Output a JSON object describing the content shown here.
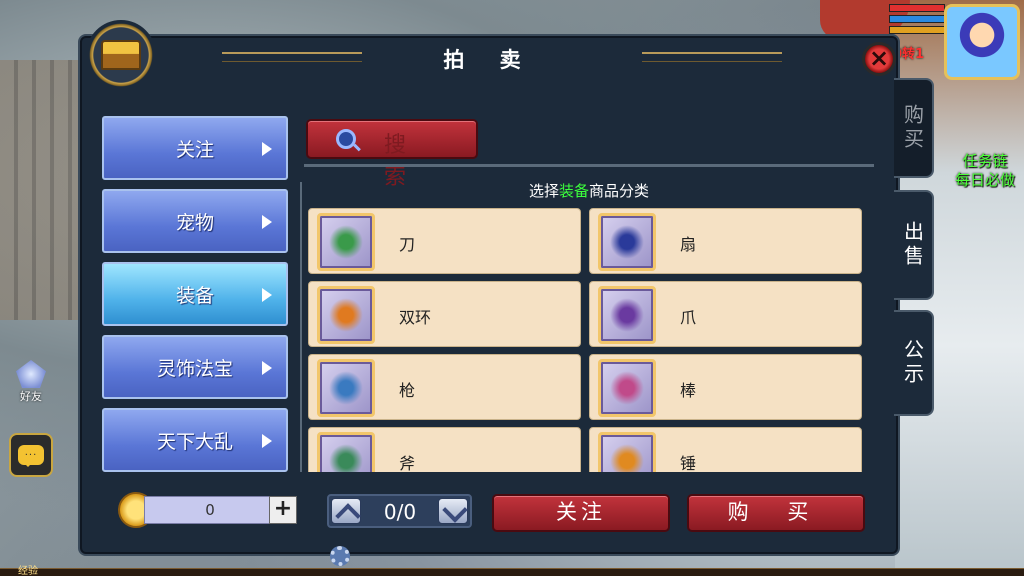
{
  "window": {
    "title": "拍 卖"
  },
  "hud": {
    "friend_label": "好友",
    "chat_icon_text": "···",
    "level_text": "0转1",
    "task_line1": "任务链",
    "task_line2": "每日必做",
    "bottom_label": "经验",
    "hp_colors": [
      "#e03030",
      "#2a8ae0",
      "#e0a020"
    ]
  },
  "categories": [
    {
      "label": "关注",
      "active": false
    },
    {
      "label": "宠物",
      "active": false
    },
    {
      "label": "装备",
      "active": true
    },
    {
      "label": "灵饰法宝",
      "active": false
    },
    {
      "label": "天下大乱",
      "active": false
    }
  ],
  "search": {
    "label": "搜 索"
  },
  "grid_header": {
    "prefix": "选择",
    "highlight": "装备",
    "suffix": "商品分类"
  },
  "items": [
    {
      "label": "刀",
      "icon": "blade-icon",
      "color": "#3a9a4a"
    },
    {
      "label": "扇",
      "icon": "fan-icon",
      "color": "#2a3a9a"
    },
    {
      "label": "双环",
      "icon": "double-ring-icon",
      "color": "#e07a20"
    },
    {
      "label": "爪",
      "icon": "claw-icon",
      "color": "#6a3aa0"
    },
    {
      "label": "枪",
      "icon": "spear-icon",
      "color": "#3a7ac0"
    },
    {
      "label": "棒",
      "icon": "staff-icon",
      "color": "#c04a8a"
    },
    {
      "label": "斧",
      "icon": "axe-icon",
      "color": "#3a8a5a"
    },
    {
      "label": "锤",
      "icon": "hammer-icon",
      "color": "#e08a20"
    }
  ],
  "footer": {
    "coin_value": "0",
    "plus_label": "+",
    "page_text": "0/0",
    "follow_label": "关注",
    "buy_label": "购 买"
  },
  "tabs": {
    "buy": "购买",
    "sell": "出售",
    "notice": "公示"
  }
}
